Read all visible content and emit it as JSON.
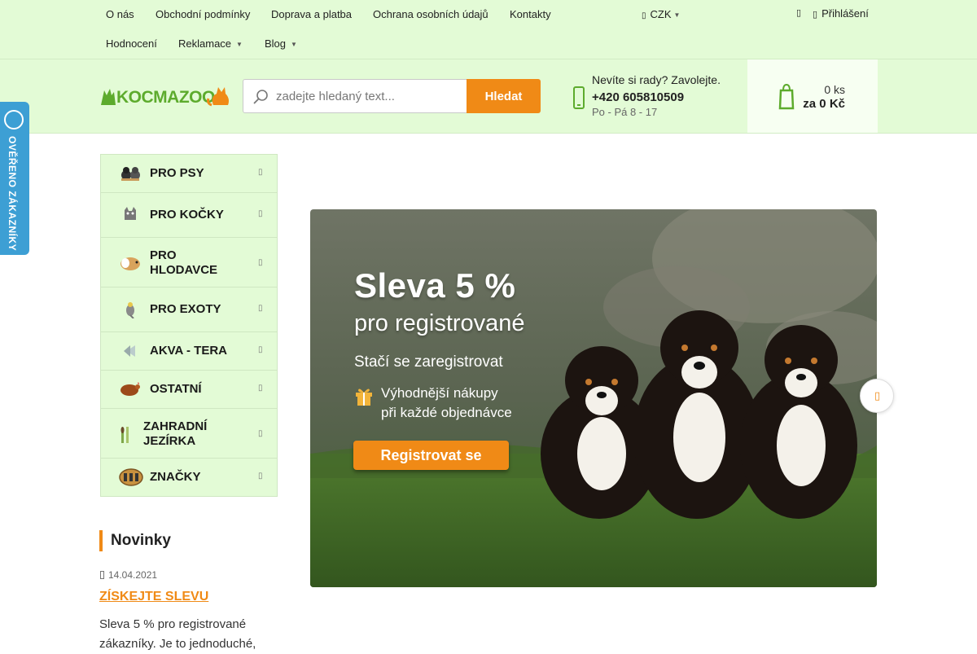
{
  "colors": {
    "accent": "#f08a16",
    "header_bg": "#e3fbd6",
    "badge_blue": "#3d9fd4"
  },
  "topnav": {
    "links": [
      "O nás",
      "Obchodní podmínky",
      "Doprava a platba",
      "Ochrana osobních údajů",
      "Kontakty"
    ],
    "row2": [
      "Hodnocení",
      "Reklamace",
      "Blog"
    ],
    "currency": "CZK",
    "login": "Přihlášení"
  },
  "header": {
    "logo_text": "KOCMAZOO",
    "search_placeholder": "zadejte hledaný text...",
    "search_button": "Hledat",
    "help_title": "Nevíte si rady? Zavolejte.",
    "help_phone": "+420 605810509",
    "help_hours": "Po - Pá 8 - 17",
    "cart_qty": "0 ks",
    "cart_total": "za 0 Kč"
  },
  "badge": {
    "text": "OVĚŘENO ZÁKAZNÍKY",
    "seal_icon": "verified-seal-icon"
  },
  "categories": [
    {
      "label": "PRO PSY",
      "icon": "dogs-icon"
    },
    {
      "label": "PRO KOČKY",
      "icon": "cat-icon"
    },
    {
      "label_lines": [
        "PRO",
        "HLODAVCE"
      ],
      "icon": "guinea-pig-icon"
    },
    {
      "label": "PRO EXOTY",
      "icon": "bird-icon"
    },
    {
      "label": "AKVA - TERA",
      "icon": "fish-icon"
    },
    {
      "label": "OSTATNÍ",
      "icon": "hen-icon"
    },
    {
      "label_lines": [
        "ZAHRADNÍ",
        "JEZÍRKA"
      ],
      "icon": "reed-icon"
    },
    {
      "label": "ZNAČKY",
      "icon": "brands-icon"
    }
  ],
  "news": {
    "title": "Novinky",
    "date": "14.04.2021",
    "link": "ZÍSKEJTE SLEVU",
    "text_lines": [
      "Sleva 5 % pro registrované",
      "zákazníky. Je to jednoduché,"
    ]
  },
  "banner": {
    "title": "Sleva 5 %",
    "subtitle": "pro registrované",
    "line": "Stačí se zaregistrovat",
    "perk_line1": "Výhodnější nákupy",
    "perk_line2": "při každé objednávce",
    "button": "Registrovat se"
  }
}
